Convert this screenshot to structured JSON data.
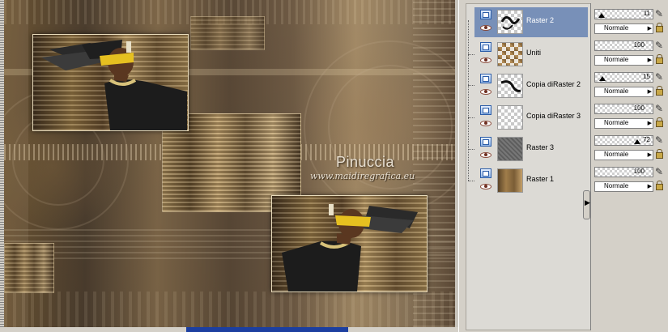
{
  "artwork": {
    "brand_title": "Pinuccia",
    "brand_url": "www.maidiregrafica.eu"
  },
  "layers_panel": {
    "layers": [
      {
        "name": "Raster 2",
        "selected": true,
        "thumb": "ornament-swirl",
        "opacity": 11,
        "blend_mode": "Normale"
      },
      {
        "name": "Uniti",
        "selected": false,
        "thumb": "merged-pattern",
        "opacity": 100,
        "blend_mode": "Normale"
      },
      {
        "name": "Copia diRaster 2",
        "selected": false,
        "thumb": "ornament-swirl",
        "opacity": 15,
        "blend_mode": "Normale"
      },
      {
        "name": "Copia diRaster 3",
        "selected": false,
        "thumb": "transparent",
        "opacity": 100,
        "blend_mode": "Normale"
      },
      {
        "name": "Raster 3",
        "selected": false,
        "thumb": "grey-fill",
        "opacity": 72,
        "blend_mode": "Normale"
      },
      {
        "name": "Raster 1",
        "selected": false,
        "thumb": "photo-texture",
        "opacity": 100,
        "blend_mode": "Normale"
      }
    ]
  },
  "colors": {
    "selection": "#7890b8",
    "panel_bg": "#d4d0c8",
    "scroll_thumb": "#1c3fa0"
  }
}
